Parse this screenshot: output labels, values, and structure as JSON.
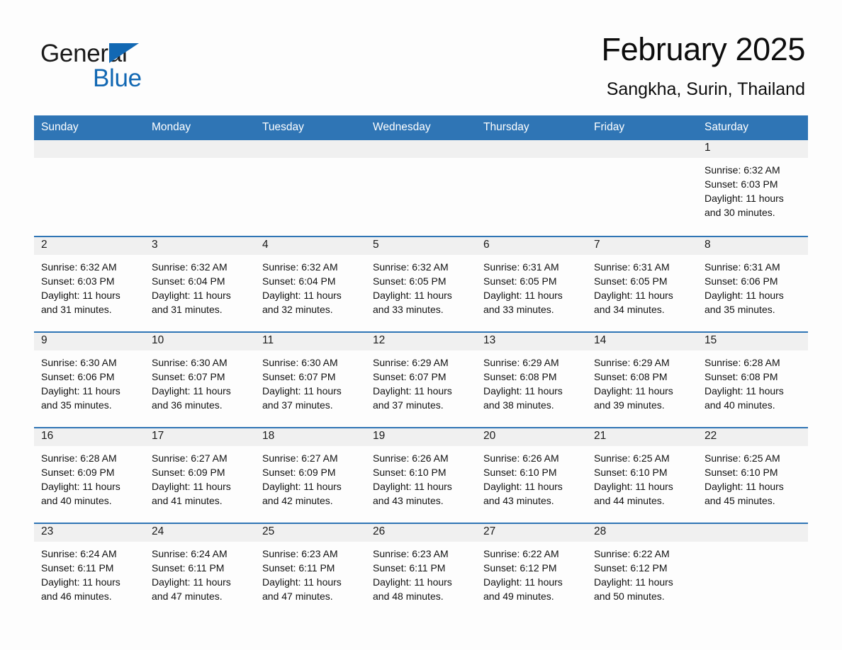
{
  "brand": {
    "name_part1": "General",
    "name_part2": "Blue",
    "logo_icon": "blue-triangle-icon",
    "accent_color": "#1268b3"
  },
  "header": {
    "title": "February 2025",
    "location": "Sangkha, Surin, Thailand"
  },
  "theme": {
    "header_blue": "#2f75b5",
    "daynum_band": "#f0f0f0",
    "page_background": "#fdfdfd"
  },
  "weekday_headers": [
    "Sunday",
    "Monday",
    "Tuesday",
    "Wednesday",
    "Thursday",
    "Friday",
    "Saturday"
  ],
  "weeks": [
    [
      {
        "day": "",
        "sunrise": "",
        "sunset": "",
        "daylight_line1": "",
        "daylight_line2": ""
      },
      {
        "day": "",
        "sunrise": "",
        "sunset": "",
        "daylight_line1": "",
        "daylight_line2": ""
      },
      {
        "day": "",
        "sunrise": "",
        "sunset": "",
        "daylight_line1": "",
        "daylight_line2": ""
      },
      {
        "day": "",
        "sunrise": "",
        "sunset": "",
        "daylight_line1": "",
        "daylight_line2": ""
      },
      {
        "day": "",
        "sunrise": "",
        "sunset": "",
        "daylight_line1": "",
        "daylight_line2": ""
      },
      {
        "day": "",
        "sunrise": "",
        "sunset": "",
        "daylight_line1": "",
        "daylight_line2": ""
      },
      {
        "day": "1",
        "sunrise": "Sunrise: 6:32 AM",
        "sunset": "Sunset: 6:03 PM",
        "daylight_line1": "Daylight: 11 hours",
        "daylight_line2": "and 30 minutes."
      }
    ],
    [
      {
        "day": "2",
        "sunrise": "Sunrise: 6:32 AM",
        "sunset": "Sunset: 6:03 PM",
        "daylight_line1": "Daylight: 11 hours",
        "daylight_line2": "and 31 minutes."
      },
      {
        "day": "3",
        "sunrise": "Sunrise: 6:32 AM",
        "sunset": "Sunset: 6:04 PM",
        "daylight_line1": "Daylight: 11 hours",
        "daylight_line2": "and 31 minutes."
      },
      {
        "day": "4",
        "sunrise": "Sunrise: 6:32 AM",
        "sunset": "Sunset: 6:04 PM",
        "daylight_line1": "Daylight: 11 hours",
        "daylight_line2": "and 32 minutes."
      },
      {
        "day": "5",
        "sunrise": "Sunrise: 6:32 AM",
        "sunset": "Sunset: 6:05 PM",
        "daylight_line1": "Daylight: 11 hours",
        "daylight_line2": "and 33 minutes."
      },
      {
        "day": "6",
        "sunrise": "Sunrise: 6:31 AM",
        "sunset": "Sunset: 6:05 PM",
        "daylight_line1": "Daylight: 11 hours",
        "daylight_line2": "and 33 minutes."
      },
      {
        "day": "7",
        "sunrise": "Sunrise: 6:31 AM",
        "sunset": "Sunset: 6:05 PM",
        "daylight_line1": "Daylight: 11 hours",
        "daylight_line2": "and 34 minutes."
      },
      {
        "day": "8",
        "sunrise": "Sunrise: 6:31 AM",
        "sunset": "Sunset: 6:06 PM",
        "daylight_line1": "Daylight: 11 hours",
        "daylight_line2": "and 35 minutes."
      }
    ],
    [
      {
        "day": "9",
        "sunrise": "Sunrise: 6:30 AM",
        "sunset": "Sunset: 6:06 PM",
        "daylight_line1": "Daylight: 11 hours",
        "daylight_line2": "and 35 minutes."
      },
      {
        "day": "10",
        "sunrise": "Sunrise: 6:30 AM",
        "sunset": "Sunset: 6:07 PM",
        "daylight_line1": "Daylight: 11 hours",
        "daylight_line2": "and 36 minutes."
      },
      {
        "day": "11",
        "sunrise": "Sunrise: 6:30 AM",
        "sunset": "Sunset: 6:07 PM",
        "daylight_line1": "Daylight: 11 hours",
        "daylight_line2": "and 37 minutes."
      },
      {
        "day": "12",
        "sunrise": "Sunrise: 6:29 AM",
        "sunset": "Sunset: 6:07 PM",
        "daylight_line1": "Daylight: 11 hours",
        "daylight_line2": "and 37 minutes."
      },
      {
        "day": "13",
        "sunrise": "Sunrise: 6:29 AM",
        "sunset": "Sunset: 6:08 PM",
        "daylight_line1": "Daylight: 11 hours",
        "daylight_line2": "and 38 minutes."
      },
      {
        "day": "14",
        "sunrise": "Sunrise: 6:29 AM",
        "sunset": "Sunset: 6:08 PM",
        "daylight_line1": "Daylight: 11 hours",
        "daylight_line2": "and 39 minutes."
      },
      {
        "day": "15",
        "sunrise": "Sunrise: 6:28 AM",
        "sunset": "Sunset: 6:08 PM",
        "daylight_line1": "Daylight: 11 hours",
        "daylight_line2": "and 40 minutes."
      }
    ],
    [
      {
        "day": "16",
        "sunrise": "Sunrise: 6:28 AM",
        "sunset": "Sunset: 6:09 PM",
        "daylight_line1": "Daylight: 11 hours",
        "daylight_line2": "and 40 minutes."
      },
      {
        "day": "17",
        "sunrise": "Sunrise: 6:27 AM",
        "sunset": "Sunset: 6:09 PM",
        "daylight_line1": "Daylight: 11 hours",
        "daylight_line2": "and 41 minutes."
      },
      {
        "day": "18",
        "sunrise": "Sunrise: 6:27 AM",
        "sunset": "Sunset: 6:09 PM",
        "daylight_line1": "Daylight: 11 hours",
        "daylight_line2": "and 42 minutes."
      },
      {
        "day": "19",
        "sunrise": "Sunrise: 6:26 AM",
        "sunset": "Sunset: 6:10 PM",
        "daylight_line1": "Daylight: 11 hours",
        "daylight_line2": "and 43 minutes."
      },
      {
        "day": "20",
        "sunrise": "Sunrise: 6:26 AM",
        "sunset": "Sunset: 6:10 PM",
        "daylight_line1": "Daylight: 11 hours",
        "daylight_line2": "and 43 minutes."
      },
      {
        "day": "21",
        "sunrise": "Sunrise: 6:25 AM",
        "sunset": "Sunset: 6:10 PM",
        "daylight_line1": "Daylight: 11 hours",
        "daylight_line2": "and 44 minutes."
      },
      {
        "day": "22",
        "sunrise": "Sunrise: 6:25 AM",
        "sunset": "Sunset: 6:10 PM",
        "daylight_line1": "Daylight: 11 hours",
        "daylight_line2": "and 45 minutes."
      }
    ],
    [
      {
        "day": "23",
        "sunrise": "Sunrise: 6:24 AM",
        "sunset": "Sunset: 6:11 PM",
        "daylight_line1": "Daylight: 11 hours",
        "daylight_line2": "and 46 minutes."
      },
      {
        "day": "24",
        "sunrise": "Sunrise: 6:24 AM",
        "sunset": "Sunset: 6:11 PM",
        "daylight_line1": "Daylight: 11 hours",
        "daylight_line2": "and 47 minutes."
      },
      {
        "day": "25",
        "sunrise": "Sunrise: 6:23 AM",
        "sunset": "Sunset: 6:11 PM",
        "daylight_line1": "Daylight: 11 hours",
        "daylight_line2": "and 47 minutes."
      },
      {
        "day": "26",
        "sunrise": "Sunrise: 6:23 AM",
        "sunset": "Sunset: 6:11 PM",
        "daylight_line1": "Daylight: 11 hours",
        "daylight_line2": "and 48 minutes."
      },
      {
        "day": "27",
        "sunrise": "Sunrise: 6:22 AM",
        "sunset": "Sunset: 6:12 PM",
        "daylight_line1": "Daylight: 11 hours",
        "daylight_line2": "and 49 minutes."
      },
      {
        "day": "28",
        "sunrise": "Sunrise: 6:22 AM",
        "sunset": "Sunset: 6:12 PM",
        "daylight_line1": "Daylight: 11 hours",
        "daylight_line2": "and 50 minutes."
      },
      {
        "day": "",
        "sunrise": "",
        "sunset": "",
        "daylight_line1": "",
        "daylight_line2": ""
      }
    ]
  ]
}
